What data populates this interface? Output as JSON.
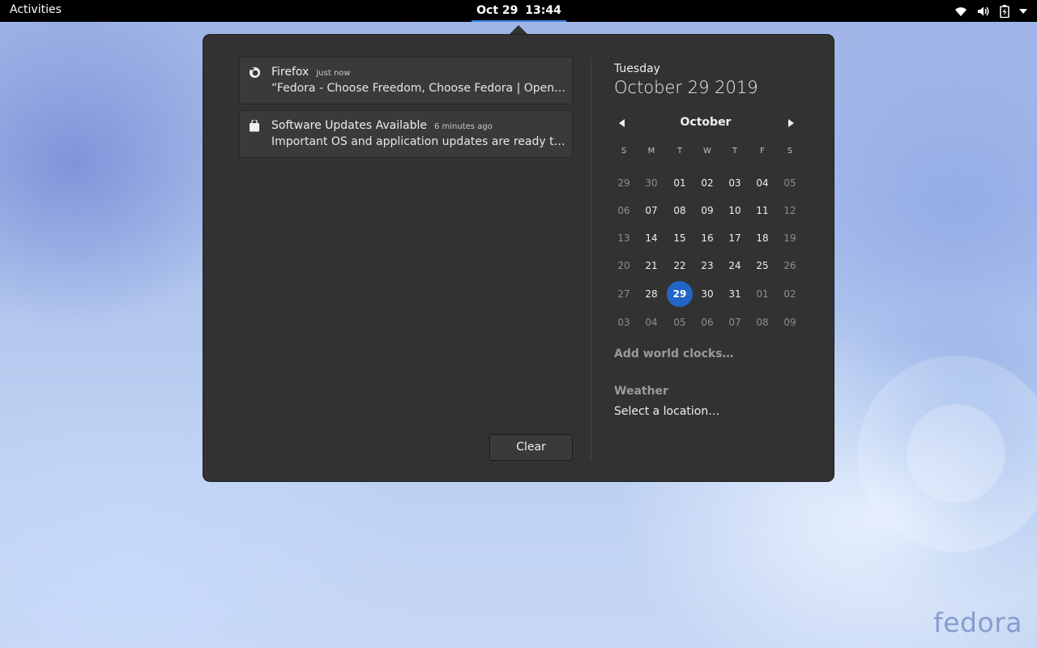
{
  "topbar": {
    "activities": "Activities",
    "date": "Oct 29",
    "time": "13:44",
    "status_icons": [
      "wifi-icon",
      "volume-icon",
      "battery-icon",
      "dropdown-arrow-icon"
    ]
  },
  "notifications": [
    {
      "app": "Firefox",
      "time": "Just now",
      "body": "“Fedora - Choose Freedom, Choose Fedora | OpenSource.com” download completed",
      "icon": "firefox-icon"
    },
    {
      "app": "Software Updates Available",
      "time": "6 minutes ago",
      "body": "Important OS and application updates are ready to be installed",
      "icon": "software-bag-icon"
    }
  ],
  "clear_label": "Clear",
  "calendar": {
    "weekday": "Tuesday",
    "full_date": "October 29 2019",
    "month": "October",
    "day_headers": [
      "S",
      "M",
      "T",
      "W",
      "T",
      "F",
      "S"
    ],
    "weeks": [
      [
        "29",
        "30",
        "01",
        "02",
        "03",
        "04",
        "05"
      ],
      [
        "06",
        "07",
        "08",
        "09",
        "10",
        "11",
        "12"
      ],
      [
        "13",
        "14",
        "15",
        "16",
        "17",
        "18",
        "19"
      ],
      [
        "20",
        "21",
        "22",
        "23",
        "24",
        "25",
        "26"
      ],
      [
        "27",
        "28",
        "29",
        "30",
        "31",
        "01",
        "02"
      ],
      [
        "03",
        "04",
        "05",
        "06",
        "07",
        "08",
        "09"
      ]
    ],
    "today": "29",
    "accent_color": "#2166c6"
  },
  "world_clocks_label": "Add world clocks…",
  "weather": {
    "title": "Weather",
    "location_prompt": "Select a location…"
  },
  "wallpaper_logo": "fedora"
}
